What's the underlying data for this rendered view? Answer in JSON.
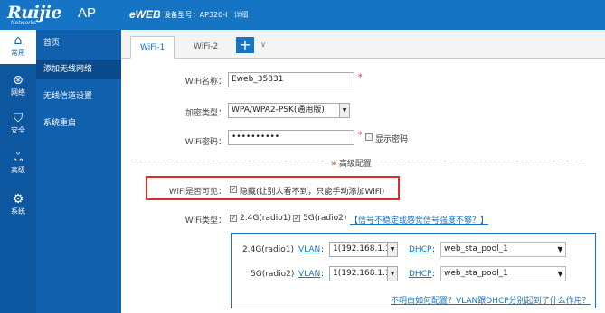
{
  "header": {
    "brand": "Ruijie",
    "brand_sub": "Networks",
    "product": "AP",
    "eweb_logo": "eWEB",
    "model_text": "设备型号：AP320-I",
    "detail_link": "详细"
  },
  "nav": {
    "icons": [
      {
        "label": "常用",
        "icon": "home-icon"
      },
      {
        "label": "网络",
        "icon": "globe-icon"
      },
      {
        "label": "安全",
        "icon": "shield-icon"
      },
      {
        "label": "高级",
        "icon": "users-icon"
      },
      {
        "label": "系统",
        "icon": "gear-icon"
      }
    ],
    "items": [
      {
        "label": "首页"
      },
      {
        "label": "添加无线网络"
      },
      {
        "label": "无线信道设置"
      },
      {
        "label": "系统重启"
      }
    ]
  },
  "tabs": {
    "items": [
      {
        "label": "WiFi-1"
      },
      {
        "label": "WiFi-2"
      }
    ],
    "add_label": "+",
    "more_label": "∨"
  },
  "form": {
    "ssid_label": "WiFi名称：",
    "ssid_value": "Eweb_35831",
    "required_mark": "*",
    "encryption_label": "加密类型：",
    "encryption_value": "WPA/WPA2-PSK(通用版)",
    "password_label": "WiFi密码：",
    "password_value": "••••••••••",
    "show_password_label": "显示密码",
    "advanced_label": "高级配置",
    "visible_label": "WiFi是否可见：",
    "hidden_label": "隐藏(让别人看不到，只能手动添加WiFi)",
    "type_label": "WiFi类型：",
    "radio1_label": "2.4G(radio1)",
    "radio2_label": "5G(radio2)",
    "signal_link": "【信号不稳定或感觉信号强度不够？】",
    "radios": [
      {
        "name": "2.4G(radio1)",
        "vlan_label": "VLAN",
        "vlan_value": "1(192.168.1.1)",
        "dhcp_label": "DHCP",
        "dhcp_value": "web_sta_pool_1"
      },
      {
        "name": "5G(radio2)",
        "vlan_label": "VLAN",
        "vlan_value": "1(192.168.1.1)",
        "dhcp_label": "DHCP",
        "dhcp_value": "web_sta_pool_1"
      }
    ],
    "help_link": "不明白如何配置？VLAN跟DHCP分别起到了什么作用？"
  },
  "colors": {
    "header_blue": "#1574c4",
    "sidebar_blue": "#1160ae",
    "highlight_red": "#d9302c"
  }
}
